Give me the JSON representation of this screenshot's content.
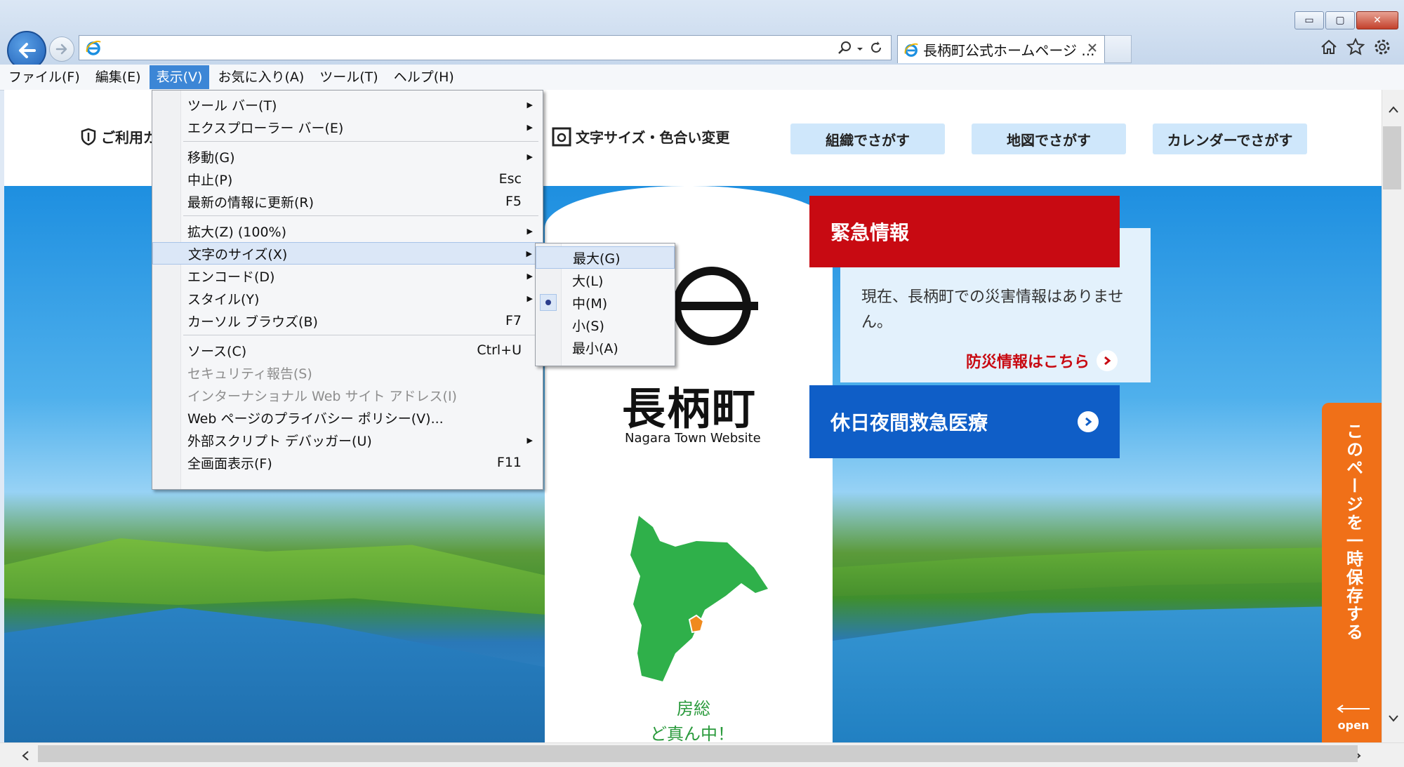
{
  "window": {
    "tab_title": "長柄町公式ホームページ ...",
    "controls": {
      "minimize": "▭",
      "maximize": "▢",
      "close": "✕"
    }
  },
  "menubar": [
    {
      "label": "ファイル(F)"
    },
    {
      "label": "編集(E)"
    },
    {
      "label": "表示(V)",
      "active": true
    },
    {
      "label": "お気に入り(A)"
    },
    {
      "label": "ツール(T)"
    },
    {
      "label": "ヘルプ(H)"
    }
  ],
  "view_menu": {
    "items": [
      {
        "label": "ツール バー(T)",
        "shortcut": "",
        "submenu": true
      },
      {
        "label": "エクスプローラー バー(E)",
        "shortcut": "",
        "submenu": true
      },
      {
        "label": "移動(G)",
        "shortcut": "",
        "submenu": true
      },
      {
        "label": "中止(P)",
        "shortcut": "Esc"
      },
      {
        "label": "最新の情報に更新(R)",
        "shortcut": "F5"
      },
      {
        "label": "拡大(Z) (100%)",
        "shortcut": "",
        "submenu": true
      },
      {
        "label": "文字のサイズ(X)",
        "shortcut": "",
        "submenu": true,
        "highlighted": true
      },
      {
        "label": "エンコード(D)",
        "shortcut": "",
        "submenu": true
      },
      {
        "label": "スタイル(Y)",
        "shortcut": "",
        "submenu": true
      },
      {
        "label": "カーソル ブラウズ(B)",
        "shortcut": "F7"
      },
      {
        "label": "ソース(C)",
        "shortcut": "Ctrl+U"
      },
      {
        "label": "セキュリティ報告(S)",
        "shortcut": "",
        "disabled": true
      },
      {
        "label": "インターナショナル Web サイト アドレス(I)",
        "shortcut": "",
        "disabled": true
      },
      {
        "label": "Web ページのプライバシー ポリシー(V)...",
        "shortcut": ""
      },
      {
        "label": "外部スクリプト デバッガー(U)",
        "shortcut": "",
        "submenu": true
      },
      {
        "label": "全画面表示(F)",
        "shortcut": "F11"
      }
    ]
  },
  "text_size_menu": {
    "items": [
      {
        "label": "最大(G)",
        "highlighted": true
      },
      {
        "label": "大(L)"
      },
      {
        "label": "中(M)",
        "selected": true
      },
      {
        "label": "小(S)"
      },
      {
        "label": "最小(A)"
      }
    ]
  },
  "site": {
    "usage_label": "ご利用ガ",
    "text_size_label": "文字サイズ・色合い変更",
    "nav_buttons": [
      "組織でさがす",
      "地図でさがす",
      "カレンダーでさがす"
    ],
    "emergency_title": "緊急情報",
    "emergency_text": "現在、長柄町での災害情報はありません。",
    "disaster_link": "防災情報はこちら",
    "holiday_care": "休日夜間救急医療",
    "logo_name": "長柄町",
    "logo_sub": "Nagara Town Website",
    "map_text1": "房総",
    "map_text2": "ど真ん中！",
    "save_tab_text": "このページを一時保存する",
    "save_tab_open": "open"
  },
  "colors": {
    "emergency": "#c80a12",
    "holiday": "#0f5ec7",
    "nav_button": "#cfe7fb",
    "save_tab": "#f07018",
    "menu_active": "#3c86d6"
  }
}
